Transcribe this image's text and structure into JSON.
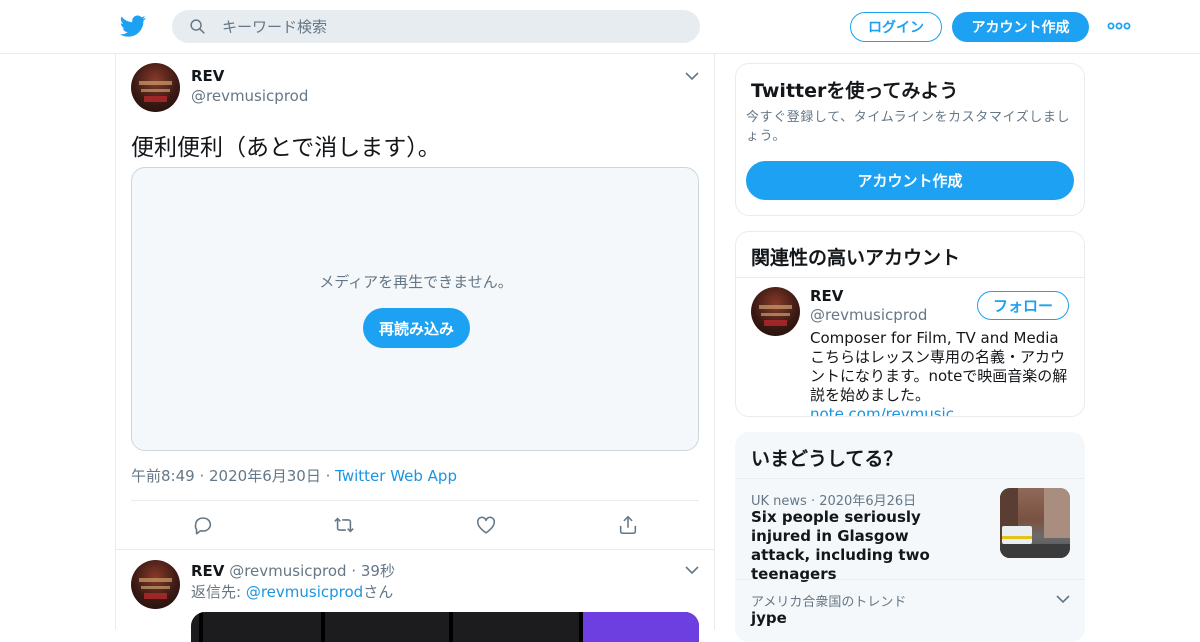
{
  "header": {
    "search_placeholder": "キーワード検索",
    "login_label": "ログイン",
    "signup_label": "アカウント作成"
  },
  "tweet": {
    "name": "REV",
    "handle": "@revmusicprod",
    "text": "便利便利（あとで消します）。",
    "media_message": "メディアを再生できません。",
    "reload_label": "再読み込み",
    "time": "午前8:49",
    "date": "2020年6月30日",
    "app": "Twitter Web App"
  },
  "reply": {
    "name": "REV",
    "handle": "@revmusicprod",
    "age": "39秒",
    "reply_prefix": "返信先: ",
    "reply_to": "@revmusicprod",
    "reply_suffix": "さん"
  },
  "signup_card": {
    "title": "Twitterを使ってみよう",
    "subtitle": "今すぐ登録して、タイムラインをカスタマイズしましょう。",
    "button_label": "アカウント作成"
  },
  "related_card": {
    "title": "関連性の高いアカウント",
    "name": "REV",
    "handle": "@revmusicprod",
    "follow_label": "フォロー",
    "bio": "Composer for Film, TV and Media こちらはレッスン専用の名義・アカウントになります。noteで映画音楽の解説を始めました。",
    "bio_link": "note.com/revmusic"
  },
  "trends_card": {
    "title": "いまどうしてる？",
    "news_source": "UK news",
    "news_date": "2020年6月26日",
    "news_headline": "Six people seriously injured in Glasgow attack, including two teenagers",
    "trend_location": "アメリカ合衆国のトレンド",
    "trend_term": "jype"
  },
  "colors": {
    "brand": "#1da1f2",
    "link": "#1b95e0",
    "secondary_text": "#657786",
    "border": "#e6ecf0"
  }
}
